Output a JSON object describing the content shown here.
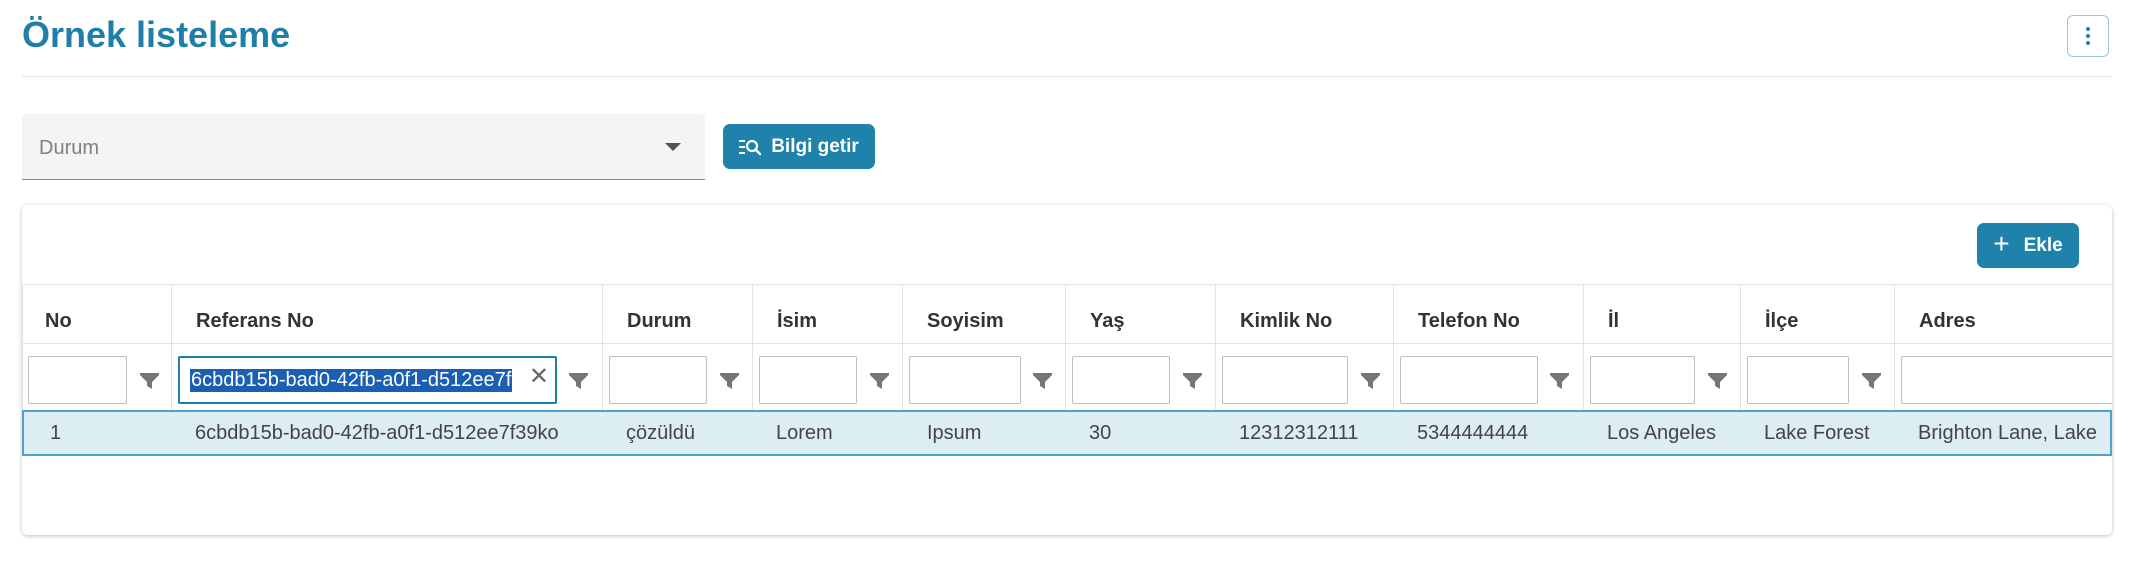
{
  "header": {
    "title": "Örnek listeleme"
  },
  "filters": {
    "status_placeholder": "Durum",
    "fetch_label": "Bilgi getir"
  },
  "toolbar": {
    "add_label": "Ekle"
  },
  "table": {
    "headers": [
      "No",
      "Referans No",
      "Durum",
      "İsim",
      "Soyisim",
      "Yaş",
      "Kimlik No",
      "Telefon No",
      "İl",
      "İlçe",
      "Adres"
    ],
    "active_filter_value": "6cbdb15b-bad0-42fb-a0f1-d512ee7f",
    "rows": [
      [
        "1",
        "6cbdb15b-bad0-42fb-a0f1-d512ee7f39ko",
        "çözüldü",
        "Lorem",
        "Ipsum",
        "30",
        "12312312111",
        "5344444444",
        "Los Angeles",
        "Lake Forest",
        "Brighton Lane, Lake"
      ]
    ]
  },
  "colors": {
    "accent": "#1f82aa",
    "title": "#1f7fa8",
    "row_selected": "#dcedf4"
  }
}
